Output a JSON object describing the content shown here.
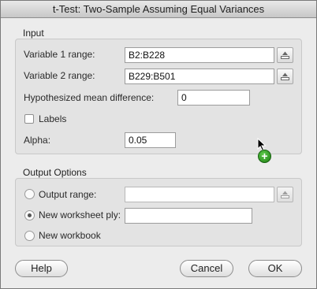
{
  "window": {
    "title": "t-Test: Two-Sample Assuming Equal Variances"
  },
  "input": {
    "group_label": "Input",
    "var1_label": "Variable 1 range:",
    "var1_value": "B2:B228",
    "var2_label": "Variable 2 range:",
    "var2_value": "B229:B501",
    "hyp_label": "Hypothesized mean difference:",
    "hyp_value": "0",
    "labels_label": "Labels",
    "labels_checked": false,
    "alpha_label": "Alpha:",
    "alpha_value": "0.05"
  },
  "output": {
    "group_label": "Output Options",
    "output_range_label": "Output range:",
    "output_range_value": "",
    "new_ply_label": "New worksheet ply:",
    "new_ply_value": "",
    "new_workbook_label": "New workbook",
    "selected": "new_worksheet_ply"
  },
  "buttons": {
    "help": "Help",
    "cancel": "Cancel",
    "ok": "OK"
  },
  "icons": {
    "range_selector": "collapse-dialog-icon",
    "cursor": "arrow-cursor-icon",
    "drag_copy": "green-plus-icon"
  }
}
